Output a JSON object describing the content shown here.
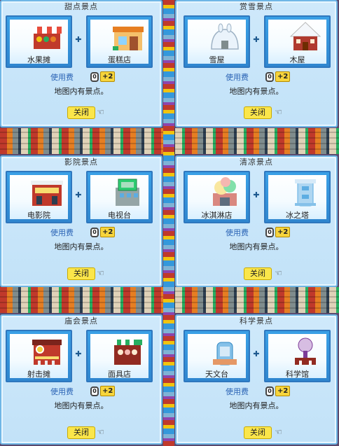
{
  "panels": [
    {
      "title": "甜点景点",
      "left": {
        "label": "水果摊",
        "icon": "fruit-stand-icon"
      },
      "right": {
        "label": "蛋糕店",
        "icon": "cake-shop-icon"
      },
      "fee_label": "使用费",
      "fee_value": "+2",
      "note": "地图内有景点。",
      "close_label": "关闭"
    },
    {
      "title": "赏雪景点",
      "left": {
        "label": "雪屋",
        "icon": "snow-house-icon"
      },
      "right": {
        "label": "木屋",
        "icon": "cabin-icon"
      },
      "fee_label": "使用费",
      "fee_value": "+2",
      "note": "地图内有景点。",
      "close_label": "关闭"
    },
    {
      "title": "影院景点",
      "left": {
        "label": "电影院",
        "icon": "cinema-icon"
      },
      "right": {
        "label": "电视台",
        "icon": "tv-station-icon"
      },
      "fee_label": "使用费",
      "fee_value": "+2",
      "note": "地图内有景点。",
      "close_label": "关闭"
    },
    {
      "title": "清凉景点",
      "left": {
        "label": "冰淇淋店",
        "icon": "ice-cream-shop-icon"
      },
      "right": {
        "label": "冰之塔",
        "icon": "ice-tower-icon"
      },
      "fee_label": "使用费",
      "fee_value": "+2",
      "note": "地图内有景点。",
      "close_label": "关闭"
    },
    {
      "title": "庙会景点",
      "left": {
        "label": "射击摊",
        "icon": "shooting-stall-icon"
      },
      "right": {
        "label": "面具店",
        "icon": "mask-shop-icon"
      },
      "fee_label": "使用费",
      "fee_value": "+2",
      "note": "地图内有景点。",
      "close_label": "关闭"
    },
    {
      "title": "科学景点",
      "left": {
        "label": "天文台",
        "icon": "observatory-icon"
      },
      "right": {
        "label": "科学馆",
        "icon": "science-museum-icon"
      },
      "fee_label": "使用费",
      "fee_value": "+2",
      "note": "地图内有景点。",
      "close_label": "关闭"
    }
  ],
  "colors": {
    "panel_bg": "#c8e6fa",
    "card_blue": "#3aa0e6",
    "button_yellow": "#fbe64a",
    "fee_blue": "#2a63b5"
  }
}
